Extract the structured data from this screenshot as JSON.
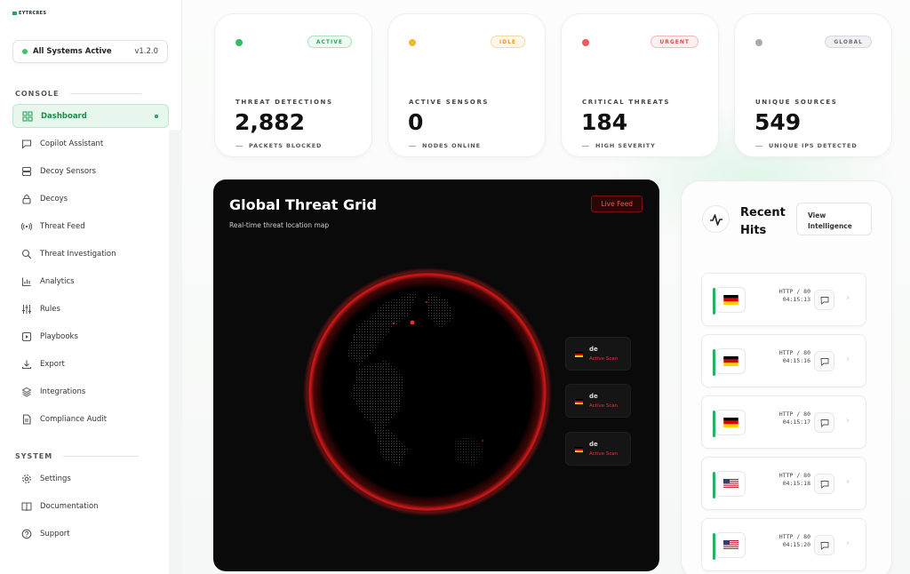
{
  "brand": {
    "logo_text": "EYTRCRES"
  },
  "sidebar": {
    "status_text": "All Systems Active",
    "version": "v1.2.0",
    "console_label": "CONSOLE",
    "system_label": "SYSTEM",
    "console_items": [
      {
        "label": "Dashboard",
        "icon": "dashboard-icon"
      },
      {
        "label": "Copilot Assistant",
        "icon": "chat-icon"
      },
      {
        "label": "Decoy Sensors",
        "icon": "server-icon"
      },
      {
        "label": "Decoys",
        "icon": "lock-icon"
      },
      {
        "label": "Threat Feed",
        "icon": "broadcast-icon"
      },
      {
        "label": "Threat Investigation",
        "icon": "search-icon"
      },
      {
        "label": "Analytics",
        "icon": "bar-chart-icon"
      },
      {
        "label": "Rules",
        "icon": "sliders-icon"
      },
      {
        "label": "Playbooks",
        "icon": "play-icon"
      },
      {
        "label": "Export",
        "icon": "download-icon"
      },
      {
        "label": "Integrations",
        "icon": "layers-icon"
      },
      {
        "label": "Compliance Audit",
        "icon": "document-icon"
      }
    ],
    "system_items": [
      {
        "label": "Settings",
        "icon": "gear-icon"
      },
      {
        "label": "Documentation",
        "icon": "book-icon"
      },
      {
        "label": "Support",
        "icon": "help-icon"
      }
    ]
  },
  "stats": [
    {
      "badge": "ACTIVE",
      "label": "THREAT DETECTIONS",
      "value": "2,882",
      "sub": "PACKETS BLOCKED",
      "dot_color": "#2fbf62",
      "badge_color": "#2fa85f"
    },
    {
      "badge": "IDLE",
      "label": "ACTIVE SENSORS",
      "value": "0",
      "sub": "NODES ONLINE",
      "dot_color": "#f1b62b",
      "badge_color": "#e39a22"
    },
    {
      "badge": "URGENT",
      "label": "CRITICAL THREATS",
      "value": "184",
      "sub": "HIGH SEVERITY",
      "dot_color": "#ef5a5a",
      "badge_color": "#e04848"
    },
    {
      "badge": "GLOBAL",
      "label": "UNIQUE SOURCES",
      "value": "549",
      "sub": "UNIQUE IPS DETECTED",
      "dot_color": "#a6aab0",
      "badge_color": "#6c7177"
    }
  ],
  "map": {
    "title": "Global Threat Grid",
    "subtitle": "Real-time threat location map",
    "live_label": "Live Feed",
    "hits": [
      {
        "country": "de",
        "status": "Active Scan"
      },
      {
        "country": "de",
        "status": "Active Scan"
      },
      {
        "country": "de",
        "status": "Active Scan"
      }
    ]
  },
  "recent": {
    "title": "Recent Hits",
    "view_label": "View Intelligence",
    "rows": [
      {
        "country": "de",
        "proto": "HTTP / 80",
        "time": "04:15:13"
      },
      {
        "country": "de",
        "proto": "HTTP / 80",
        "time": "04:15:16"
      },
      {
        "country": "de",
        "proto": "HTTP / 80",
        "time": "04:15:17"
      },
      {
        "country": "us",
        "proto": "HTTP / 80",
        "time": "04:15:18"
      },
      {
        "country": "us",
        "proto": "HTTP / 80",
        "time": "04:15:20"
      }
    ]
  }
}
